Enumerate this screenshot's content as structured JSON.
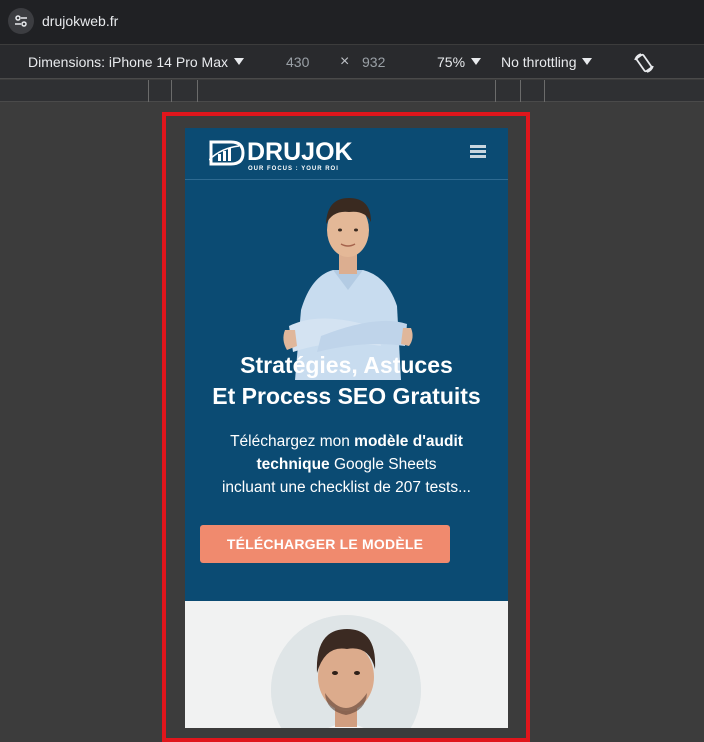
{
  "browser": {
    "url": "drujokweb.fr",
    "site_info_icon": "tune-icon"
  },
  "devtools": {
    "dimensions_label": "Dimensions: iPhone 14 Pro Max",
    "width": "430",
    "times": "×",
    "height": "932",
    "zoom": "75%",
    "throttling": "No throttling",
    "rotate_icon": "rotate-icon"
  },
  "site": {
    "logo_text": "DRUJOK",
    "logo_tagline": "OUR FOCUS : YOUR ROI",
    "menu_icon": "hamburger-icon",
    "hero": {
      "title_line1": "Stratégies, Astuces",
      "title_line2": "Et Process SEO Gratuits",
      "sub_pre": "Téléchargez mon ",
      "sub_bold1": "modèle d'audit technique",
      "sub_mid": " Google Sheets",
      "sub_line3": "incluant une checklist de 207 tests...",
      "cta_label": "TÉLÉCHARGER LE MODÈLE"
    }
  },
  "colors": {
    "hero_bg": "#0b4b73",
    "cta_bg": "#f08a6e",
    "highlight_border": "#e0161c",
    "section2_bg": "#f1f2f2"
  }
}
